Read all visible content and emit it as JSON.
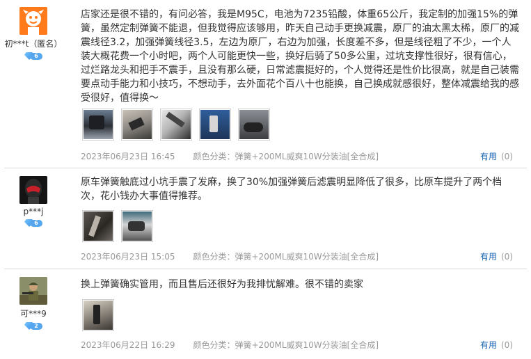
{
  "reviews": [
    {
      "username": "初***t（匿名）",
      "level": "6",
      "text": "店家还是很不错的，有问必答，我是M95C，电池为7235铅酸，体重65公斤，我定制的加强15%的弹簧，虽然定制弹簧不能退，但我觉得应该够用，昨天自己动手更换减震，原厂的油太黑太稀，原厂的减震线径3.2，加强弹簧线径3.5，左边为原厂，右边为加强，长度差不多，但是线径粗了不少，一个人装大概花费一个小时吧，两个人可能更快一些，换好后骑了50多公里，过坑支撑性很好，很有信心，过烂路龙头和把手不震手，且没有那么硬，日常滤震挺好的，个人觉得还是性价比很高，就是自己装需要点动手能力和小技巧，不想动手，去外面花个百八十也能换，自己换成就感很好，整体减震给我的感受很好，值得换～",
      "date": "2023年06月23日 16:45",
      "color_label": "颜色分类：",
      "color_value": "弹簧+200ML威爽10W分装油[全合成]",
      "helpful_label": "有用",
      "helpful_count": "(0)"
    },
    {
      "username": "p***j",
      "level": "6",
      "text": "原车弹簧触底过小坑手震了发麻，换了30%加强弹簧后滤震明显降低了很多，比原车提升了两个档次，花小钱办大事值得推荐。",
      "date": "2023年06月23日 15:05",
      "color_label": "颜色分类：",
      "color_value": "弹簧+200ML威爽10W分装油[全合成]",
      "helpful_label": "有用",
      "helpful_count": "(0)"
    },
    {
      "username": "可***9",
      "level": "2",
      "text": "换上弹簧确实管用，而且售后还很好为我排忧解难。很不错的卖家",
      "date": "2023年06月22日 16:29",
      "color_label": "颜色分类：",
      "color_value": "弹簧+200ML威爽10W分装油[全合成]",
      "helpful_label": "有用",
      "helpful_count": "(0)"
    }
  ],
  "colors": {
    "link": "#1a66b3",
    "meta": "#999999",
    "divider": "#d9d9d9",
    "avatar1": "#ff7a1a"
  }
}
